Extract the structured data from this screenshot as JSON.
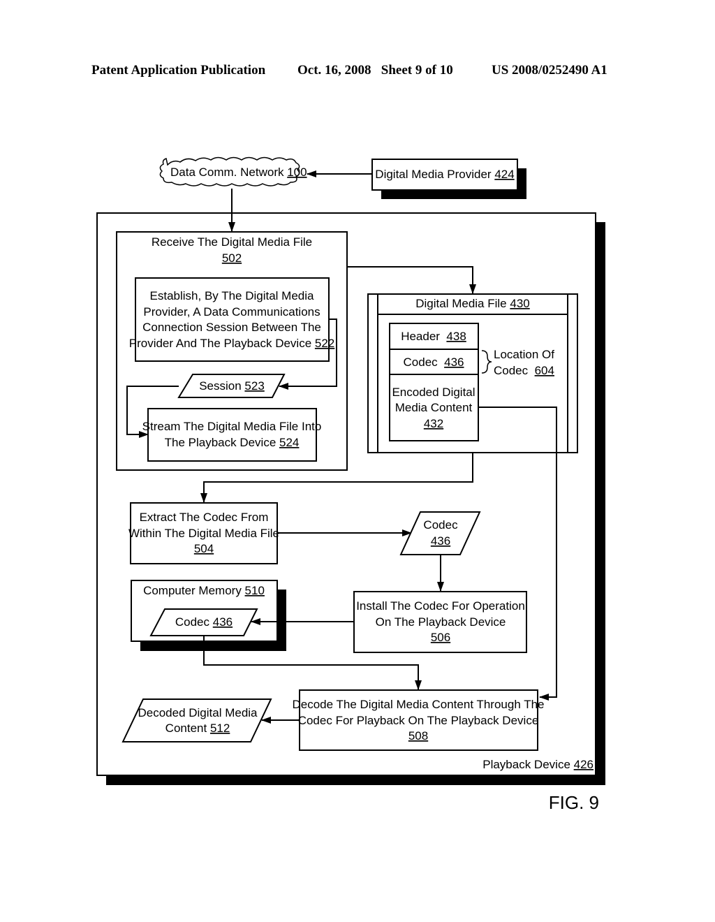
{
  "header": {
    "publication": "Patent Application Publication",
    "date_sheet": "Oct. 16, 2008   Sheet 9 of 10",
    "number": "US 2008/0252490 A1"
  },
  "nodes": {
    "network": {
      "label": "Data Comm. Network ",
      "ref": "100"
    },
    "provider": {
      "label": "Digital Media Provider ",
      "ref": "424"
    },
    "receive": {
      "label": "Receive The Digital Media File",
      "ref": "502"
    },
    "establish": {
      "lines": [
        "Establish, By The Digital Media",
        "Provider, A Data Communications",
        "Connection Session Between The",
        "Provider And The Playback Device "
      ],
      "ref": "522"
    },
    "session": {
      "label": "Session ",
      "ref": "523"
    },
    "stream": {
      "lines": [
        "Stream The Digital Media File Into",
        "The Playback Device "
      ],
      "ref": "524"
    },
    "media_file": {
      "label": "Digital Media File ",
      "ref": "430"
    },
    "header_field": {
      "label": "Header  ",
      "ref": "438"
    },
    "codec_field": {
      "label": "Codec  ",
      "ref": "436"
    },
    "encoded": {
      "lines": [
        "Encoded Digital",
        "Media Content"
      ],
      "ref": "432"
    },
    "location": {
      "lines": [
        "Location Of",
        "Codec  "
      ],
      "ref": "604"
    },
    "extract": {
      "lines": [
        "Extract The Codec From",
        "Within The Digital Media File"
      ],
      "ref": "504"
    },
    "codec_data": {
      "label": "Codec",
      "ref": "436"
    },
    "memory": {
      "label": "Computer Memory ",
      "ref": "510"
    },
    "memory_codec": {
      "label": "Codec ",
      "ref": "436"
    },
    "install": {
      "lines": [
        "Install The Codec For Operation",
        "On The Playback Device"
      ],
      "ref": "506"
    },
    "decoded": {
      "lines": [
        "Decoded Digital Media",
        "Content "
      ],
      "ref": "512"
    },
    "decode": {
      "lines": [
        "Decode The Digital Media Content Through The",
        "Codec For Playback On The Playback Device"
      ],
      "ref": "508"
    },
    "playback_device": {
      "label": "Playback Device ",
      "ref": "426"
    }
  },
  "figure_label": "FIG. 9"
}
